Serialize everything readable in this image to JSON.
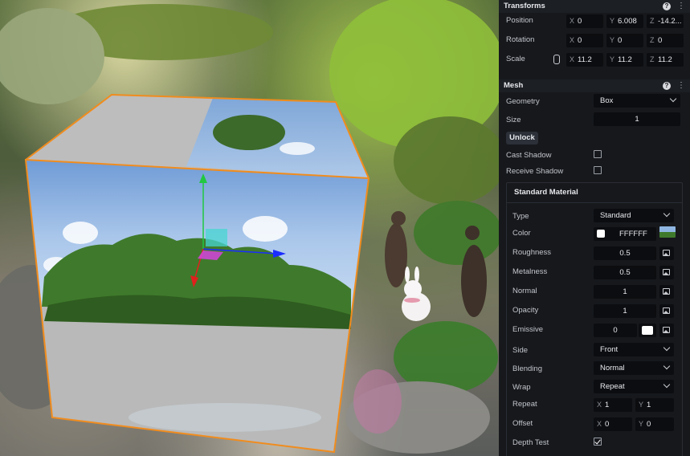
{
  "transforms": {
    "title": "Transforms",
    "position": {
      "label": "Position",
      "x": "0",
      "y": "6.008",
      "z": "-14.2..."
    },
    "rotation": {
      "label": "Rotation",
      "x": "0",
      "y": "0",
      "z": "0"
    },
    "scale": {
      "label": "Scale",
      "x": "11.2",
      "y": "11.2",
      "z": "11.2"
    },
    "axes": {
      "x": "X",
      "y": "Y",
      "z": "Z"
    }
  },
  "mesh": {
    "title": "Mesh",
    "geometry": {
      "label": "Geometry",
      "value": "Box"
    },
    "size": {
      "label": "Size",
      "value": "1"
    },
    "unlock_label": "Unlock",
    "cast_shadow": {
      "label": "Cast Shadow",
      "checked": false
    },
    "receive_shadow": {
      "label": "Receive Shadow",
      "checked": false
    }
  },
  "material": {
    "title": "Standard Material",
    "type": {
      "label": "Type",
      "value": "Standard"
    },
    "color": {
      "label": "Color",
      "value": "FFFFFF",
      "swatch": "#ffffff"
    },
    "roughness": {
      "label": "Roughness",
      "value": "0.5"
    },
    "metalness": {
      "label": "Metalness",
      "value": "0.5"
    },
    "normal": {
      "label": "Normal",
      "value": "1"
    },
    "opacity": {
      "label": "Opacity",
      "value": "1"
    },
    "emissive": {
      "label": "Emissive",
      "value": "0",
      "swatch": "#ffffff"
    },
    "side": {
      "label": "Side",
      "value": "Front"
    },
    "blending": {
      "label": "Blending",
      "value": "Normal"
    },
    "wrap": {
      "label": "Wrap",
      "value": "Repeat"
    },
    "repeat": {
      "label": "Repeat",
      "x": "1",
      "y": "1"
    },
    "offset": {
      "label": "Offset",
      "x": "0",
      "y": "0"
    },
    "depth_test": {
      "label": "Depth Test",
      "checked": true
    }
  },
  "colors": {
    "panel": "#16181c",
    "field": "#0c0d10",
    "selection_outline": "#f08c1e",
    "gizmo_x": "#1a2cff",
    "gizmo_y": "#21c840",
    "gizmo_z": "#e0201c"
  }
}
